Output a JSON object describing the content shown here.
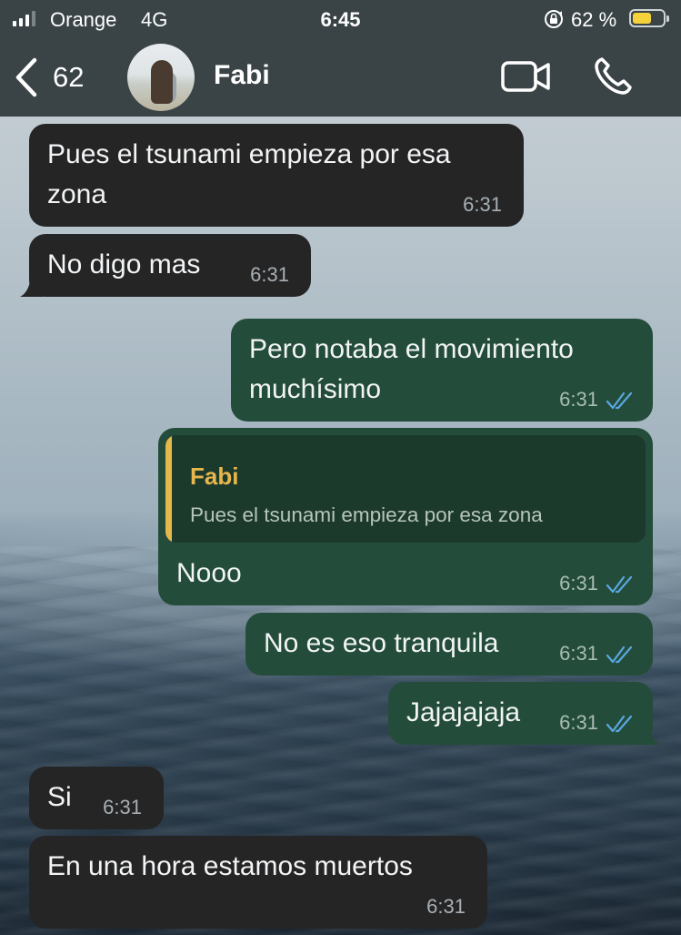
{
  "status_bar": {
    "carrier": "Orange",
    "network": "4G",
    "time": "6:45",
    "battery_percent": "62 %",
    "battery_level": 0.62
  },
  "header": {
    "back_count": "62",
    "contact_name": "Fabi"
  },
  "messages": [
    {
      "direction": "incoming",
      "text": "Pues el tsunami empieza por esa zona",
      "time": "6:31"
    },
    {
      "direction": "incoming",
      "text": "No digo mas",
      "time": "6:31"
    },
    {
      "direction": "outgoing",
      "text": "Pero notaba el movimiento muchísimo",
      "time": "6:31",
      "read": true
    },
    {
      "direction": "outgoing",
      "text": "Nooo",
      "time": "6:31",
      "read": true,
      "quoted": {
        "author": "Fabi",
        "text": "Pues el tsunami empieza por esa zona"
      }
    },
    {
      "direction": "outgoing",
      "text": "No es eso tranquila",
      "time": "6:31",
      "read": true
    },
    {
      "direction": "outgoing",
      "text": "Jajajajaja",
      "time": "6:31",
      "read": true
    },
    {
      "direction": "incoming",
      "text": "Si",
      "time": "6:31"
    },
    {
      "direction": "incoming",
      "text": "En una hora estamos muertos",
      "time": "6:31"
    }
  ],
  "colors": {
    "incoming_bubble": "#252526",
    "outgoing_bubble": "#234d3a",
    "read_ticks": "#5aa7e0",
    "quote_accent": "#e4b94a",
    "bar_background": "#3a4447"
  }
}
